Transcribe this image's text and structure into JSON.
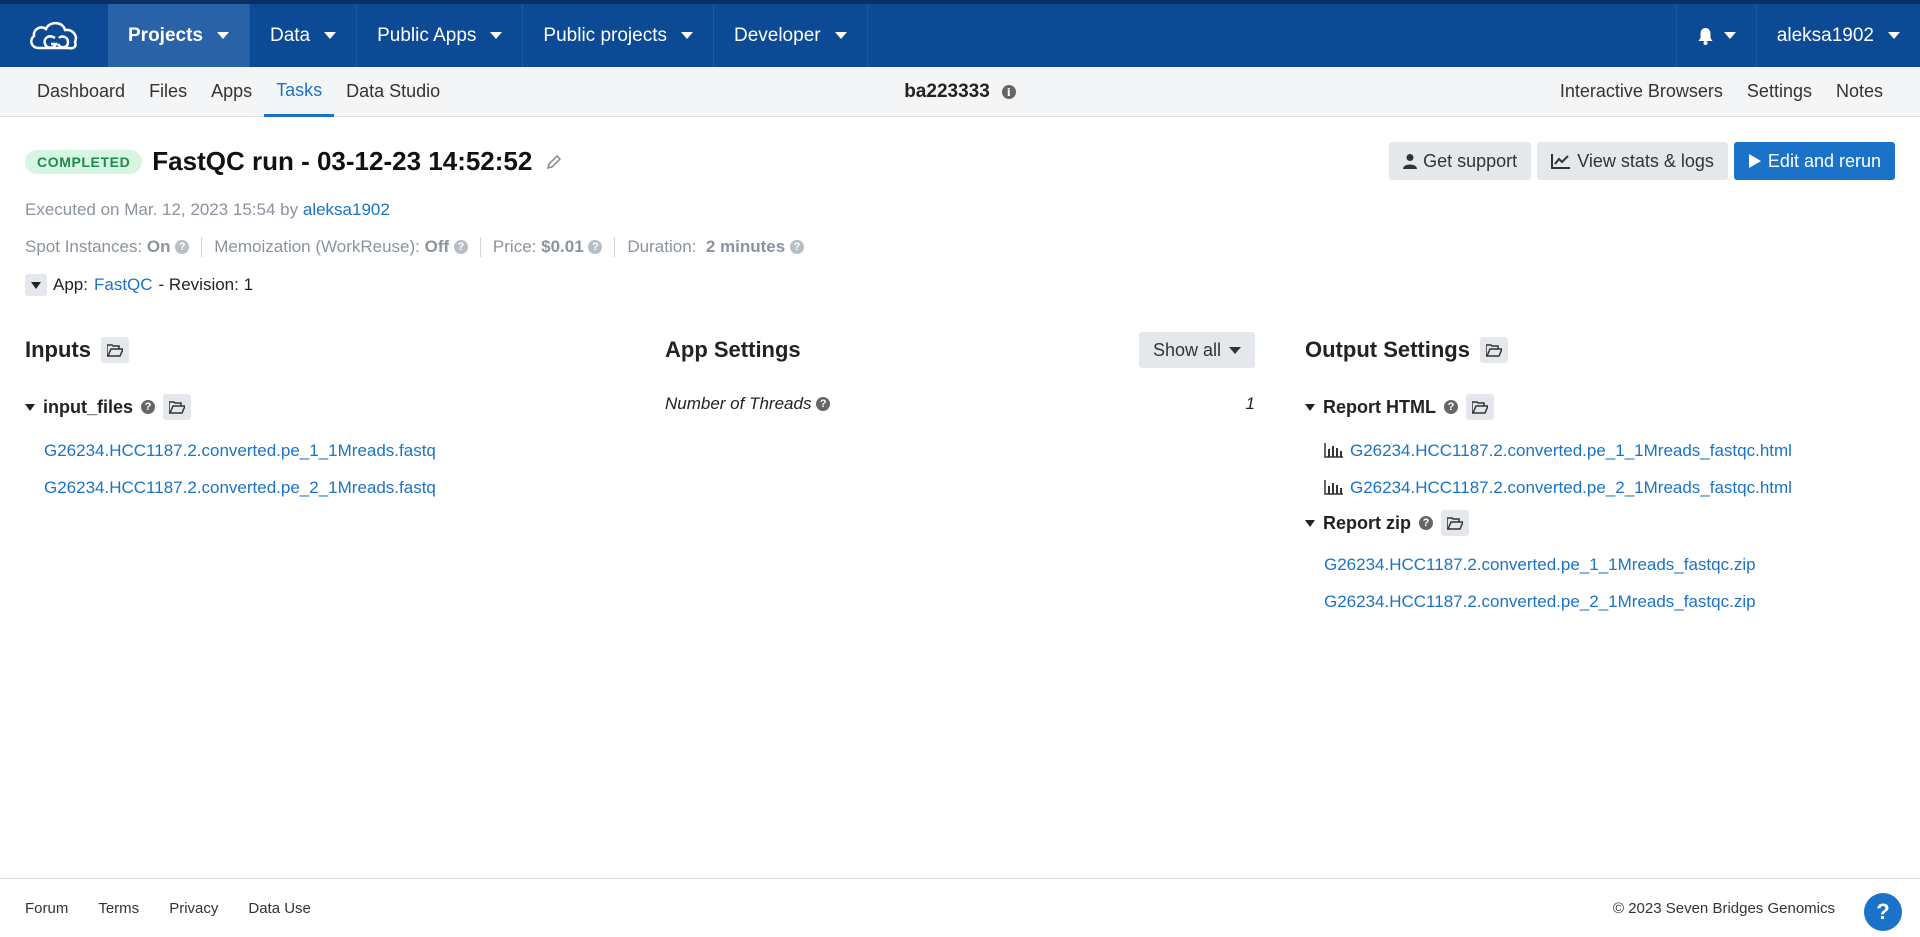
{
  "nav": {
    "items": [
      {
        "label": "Projects"
      },
      {
        "label": "Data"
      },
      {
        "label": "Public Apps"
      },
      {
        "label": "Public projects"
      },
      {
        "label": "Developer"
      }
    ],
    "user": "aleksa1902"
  },
  "subnav": {
    "tabs": [
      "Dashboard",
      "Files",
      "Apps",
      "Tasks",
      "Data Studio"
    ],
    "project_name": "ba223333",
    "right_links": [
      "Interactive Browsers",
      "Settings",
      "Notes"
    ]
  },
  "task": {
    "status": "COMPLETED",
    "title": "FastQC run - 03-12-23 14:52:52",
    "executed_prefix": "Executed on Mar. 12, 2023 15:54 by",
    "executed_user": "aleksa1902",
    "spot_label": "Spot Instances:",
    "spot_value": "On",
    "memo_label": "Memoization (WorkReuse):",
    "memo_value": "Off",
    "price_label": "Price:",
    "price_value": "$0.01",
    "duration_label": "Duration:",
    "duration_value": "2 minutes",
    "app_label": "App:",
    "app_name": "FastQC",
    "revision": "- Revision: 1"
  },
  "actions": {
    "support": "Get support",
    "stats": "View stats & logs",
    "rerun": "Edit and rerun"
  },
  "inputs": {
    "heading": "Inputs",
    "group": "input_files",
    "files": [
      "G26234.HCC1187.2.converted.pe_1_1Mreads.fastq",
      "G26234.HCC1187.2.converted.pe_2_1Mreads.fastq"
    ]
  },
  "app_settings": {
    "heading": "App Settings",
    "show_all": "Show all",
    "threads_label": "Number of Threads",
    "threads_value": "1"
  },
  "outputs": {
    "heading": "Output Settings",
    "html_group": "Report HTML",
    "html_files": [
      "G26234.HCC1187.2.converted.pe_1_1Mreads_fastqc.html",
      "G26234.HCC1187.2.converted.pe_2_1Mreads_fastqc.html"
    ],
    "zip_group": "Report zip",
    "zip_files": [
      "G26234.HCC1187.2.converted.pe_1_1Mreads_fastqc.zip",
      "G26234.HCC1187.2.converted.pe_2_1Mreads_fastqc.zip"
    ]
  },
  "footer": {
    "links": [
      "Forum",
      "Terms",
      "Privacy",
      "Data Use"
    ],
    "copyright": "© 2023 Seven Bridges Genomics",
    "help": "?"
  },
  "colors": {
    "nav_bg": "#0d4a96",
    "accent": "#1a73c8",
    "completed_bg": "#d6f5e3",
    "completed_text": "#1e8a4a"
  }
}
